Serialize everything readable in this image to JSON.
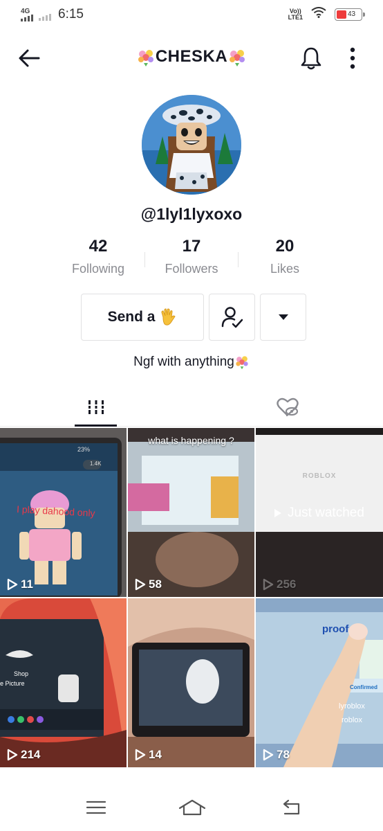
{
  "status_bar": {
    "network": "4G",
    "time": "6:15",
    "volte_line1": "Vo))",
    "volte_line2": "LTE1",
    "battery": "43"
  },
  "header": {
    "title": "CHESKA",
    "back_icon": "arrow-left-icon",
    "bell_icon": "bell-icon",
    "more_icon": "more-vertical-icon"
  },
  "profile": {
    "username": "@1lyl1lyxoxo",
    "bio": "Ngf with anything",
    "stats": [
      {
        "value": "42",
        "label": "Following"
      },
      {
        "value": "17",
        "label": "Followers"
      },
      {
        "value": "20",
        "label": "Likes"
      }
    ],
    "send_button": "Send a"
  },
  "tabs": [
    {
      "icon": "grid-icon",
      "selected": true
    },
    {
      "icon": "hidden-liked-icon",
      "selected": false
    }
  ],
  "videos": [
    {
      "views": "11",
      "overlay": "I play dahood only",
      "status_text": "23%",
      "badge": "1.4K"
    },
    {
      "views": "58",
      "caption": "what is happening ?"
    },
    {
      "views": "256",
      "status": "Just watched",
      "screen_text": "ROBLOX"
    },
    {
      "views": "214",
      "overlay_labels": [
        "Shop",
        "e Picture"
      ]
    },
    {
      "views": "14"
    },
    {
      "views": "78",
      "screen_words": [
        "proof",
        "Confirmed",
        "lyroblox",
        "roblox"
      ]
    }
  ],
  "colors": {
    "text": "#161823",
    "muted": "#8a8b91",
    "border": "#e1e1e2",
    "accent_red": "#ee3b3b"
  }
}
